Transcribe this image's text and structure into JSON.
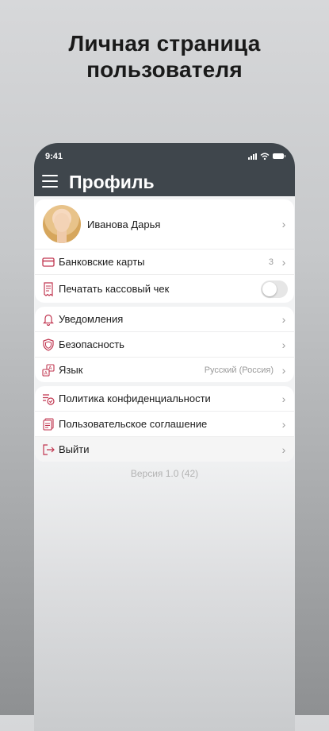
{
  "headline": "Личная страница\nпользователя",
  "status": {
    "time": "9:41"
  },
  "header": {
    "title": "Профиль"
  },
  "profile": {
    "name": "Иванова Дарья"
  },
  "payments": [
    {
      "label": "Банковские карты",
      "value": "3",
      "icon": "credit-card-icon"
    },
    {
      "label": "Печатать кассовый чек",
      "toggle": false,
      "icon": "receipt-icon"
    }
  ],
  "settings": [
    {
      "label": "Уведомления",
      "icon": "bell-icon"
    },
    {
      "label": "Безопасность",
      "icon": "shield-icon"
    },
    {
      "label": "Язык",
      "value": "Русский (Россия)",
      "icon": "language-icon"
    }
  ],
  "legal": [
    {
      "label": "Политика конфиденциальности",
      "icon": "privacy-policy-icon"
    },
    {
      "label": "Пользовательское соглашение",
      "icon": "user-agreement-icon"
    },
    {
      "label": "Выйти",
      "icon": "logout-icon"
    }
  ],
  "version": "Версия 1.0 (42)",
  "colors": {
    "accent": "#c0354f",
    "header": "#3f464c"
  }
}
